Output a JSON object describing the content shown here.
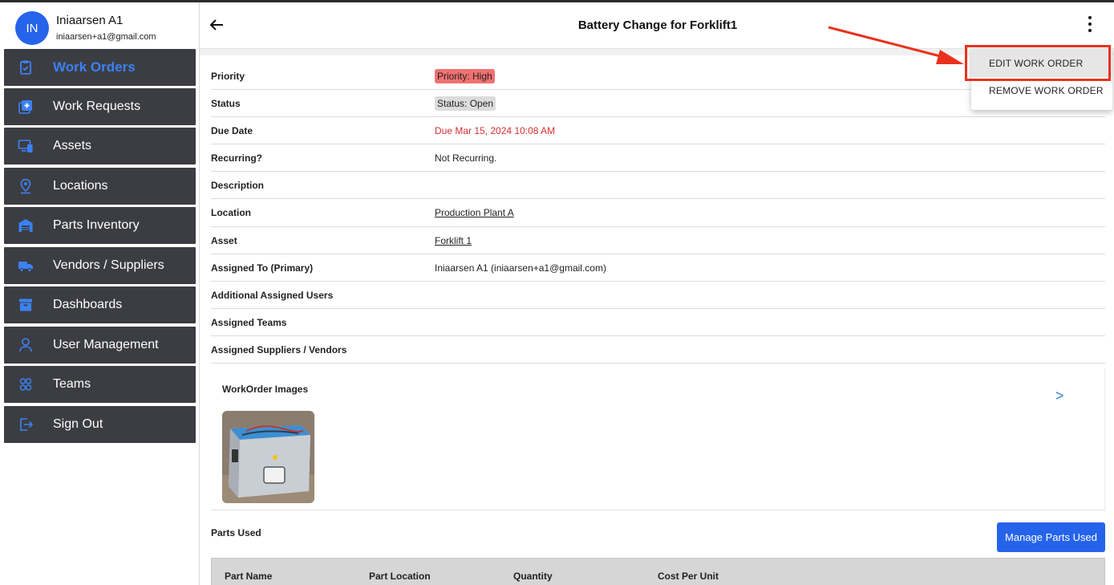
{
  "user": {
    "initials": "IN",
    "name": "Iniaarsen A1",
    "email": "iniaarsen+a1@gmail.com"
  },
  "sidebar": {
    "items": [
      {
        "label": "Work Orders",
        "icon": "clipboard-icon",
        "active": true
      },
      {
        "label": "Work Requests",
        "icon": "add-request-icon"
      },
      {
        "label": "Assets",
        "icon": "devices-icon"
      },
      {
        "label": "Locations",
        "icon": "map-pin-icon"
      },
      {
        "label": "Parts Inventory",
        "icon": "warehouse-icon"
      },
      {
        "label": "Vendors / Suppliers",
        "icon": "truck-icon"
      },
      {
        "label": "Dashboards",
        "icon": "archive-icon"
      },
      {
        "label": "User Management",
        "icon": "user-icon"
      },
      {
        "label": "Teams",
        "icon": "team-icon"
      },
      {
        "label": "Sign Out",
        "icon": "sign-out-icon"
      }
    ]
  },
  "header": {
    "title": "Battery Change for Forklift1"
  },
  "details": {
    "priority": {
      "label": "Priority",
      "value": "Priority: High"
    },
    "status": {
      "label": "Status",
      "value": "Status: Open"
    },
    "due": {
      "label": "Due Date",
      "value": "Due Mar 15, 2024 10:08 AM"
    },
    "recurring": {
      "label": "Recurring?",
      "value": "Not Recurring."
    },
    "description": {
      "label": "Description",
      "value": ""
    },
    "location": {
      "label": "Location",
      "value": "Production Plant A"
    },
    "asset": {
      "label": "Asset",
      "value": "Forklift 1"
    },
    "assigned_primary": {
      "label": "Assigned To (Primary)",
      "value": "Iniaarsen A1 (iniaarsen+a1@gmail.com)"
    },
    "additional_users": {
      "label": "Additional Assigned Users",
      "value": ""
    },
    "teams": {
      "label": "Assigned Teams",
      "value": ""
    },
    "vendors": {
      "label": "Assigned Suppliers / Vendors",
      "value": ""
    }
  },
  "images": {
    "title": "WorkOrder Images",
    "next": ">"
  },
  "parts": {
    "title": "Parts Used",
    "manage_label": "Manage Parts Used",
    "columns": [
      "Part Name",
      "Part Location",
      "Quantity",
      "Cost Per Unit"
    ]
  },
  "menu": {
    "items": [
      "EDIT WORK ORDER",
      "REMOVE WORK ORDER"
    ]
  },
  "colors": {
    "accent": "#2563eb",
    "nav_bg": "#3c3d42",
    "priority_high": "#f07171",
    "due": "#d32f2f",
    "annotation": "#e8321e"
  }
}
